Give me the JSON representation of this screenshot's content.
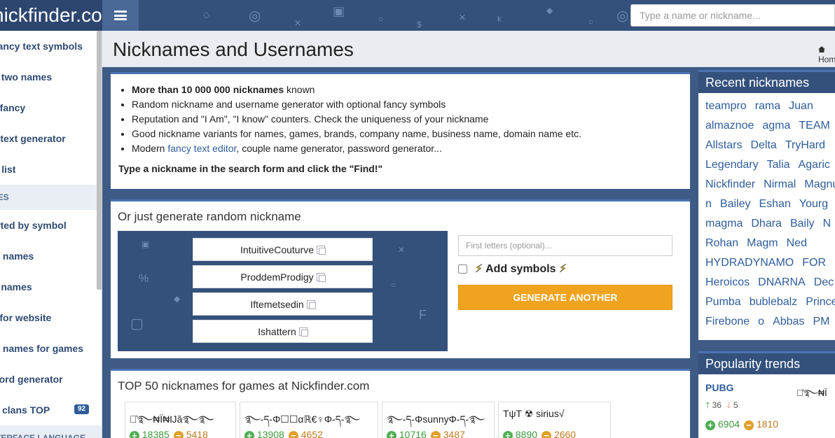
{
  "header": {
    "logo": "nickfinder.com",
    "search_placeholder": "Type a name or nickname..."
  },
  "sidebar": {
    "items": [
      {
        "label": "Fancy text symbols",
        "type": "item"
      },
      {
        "label": "Combine two names",
        "type": "item"
      },
      {
        "label": "Text fancy",
        "type": "item"
      },
      {
        "label": "Fancy text generator",
        "type": "item"
      },
      {
        "label": "Symbols list",
        "type": "item"
      },
      {
        "label": "NICKNAMES",
        "type": "section"
      },
      {
        "label": "Nicknames sorted by symbol",
        "type": "item"
      },
      {
        "label": "Random names",
        "type": "item"
      },
      {
        "label": "Couple names",
        "type": "item"
      },
      {
        "label": "Usernames for website",
        "type": "item"
      },
      {
        "label": "Random names for games",
        "type": "item"
      },
      {
        "label": "Password generator",
        "type": "item"
      },
      {
        "label": "Gaming clans TOP",
        "type": "item",
        "badge": "92"
      },
      {
        "label": "INTERFACE LANGUAGE",
        "type": "section"
      }
    ]
  },
  "page": {
    "title": "Nicknames and Usernames",
    "breadcrumb": "Home"
  },
  "intro": {
    "bullet1_bold": "More than 10 000 000 nicknames",
    "bullet1_rest": " known",
    "bullet2": "Random nickname and username generator with optional fancy symbols",
    "bullet3": "Reputation and \"I Am\", \"I know\" counters. Check the uniqueness of your nickname",
    "bullet4": "Good nickname variants for names, games, brands, company name, business name, domain name etc.",
    "bullet5_pre": "Modern ",
    "bullet5_link": "fancy text editor",
    "bullet5_post": ", couple name generator, password generator...",
    "cta": "Type a nickname in the search form and click the \"Find!\""
  },
  "generator": {
    "heading": "Or just generate random nickname",
    "names": [
      "IntuitiveCouturve",
      "ProddemProdigy",
      "Iftemetsedin",
      "Ishattern"
    ],
    "first_letters_placeholder": "First letters (optional)...",
    "add_symbols_label": "Add symbols",
    "button_label": "GENERATE ANOTHER"
  },
  "top": {
    "heading": "TOP 50 nicknames for games at Nickfinder.com",
    "cards": [
      {
        "nick": "࿐͐࿐₦Ï₦Ĳă࿐࿐",
        "up": "18385",
        "down": "5418"
      },
      {
        "nick": "࿐-ད-Φ☐☐αℝ€♀Φ-ད-࿐",
        "up": "13908",
        "down": "4652"
      },
      {
        "nick": "࿐-ད-ΦsunnyΦ-ད-࿐",
        "up": "10716",
        "down": "3487"
      },
      {
        "nick": "TψT ☢ sirius√",
        "up": "8890",
        "down": "2660"
      }
    ]
  },
  "recent": {
    "heading": "Recent nicknames",
    "rows": [
      [
        "teampro",
        "rama",
        "Juan"
      ],
      [
        "almaznoe",
        "agma",
        "TEAM"
      ],
      [
        "Allstars",
        "Delta",
        "TryHard"
      ],
      [
        "Legendary",
        "Talia",
        "Agaric"
      ],
      [
        "Nickfinder",
        "Nirmal",
        "Magnus"
      ],
      [
        "n",
        "Bailey",
        "Eshan",
        "Yourg"
      ],
      [
        "magma",
        "Dhara",
        "Baily",
        "N"
      ],
      [
        "Rohan",
        "Magm",
        "Ned"
      ],
      [
        "HYDRADYNAMO",
        "FOR"
      ],
      [
        "Heroicos",
        "DNARNA",
        "Dec"
      ],
      [
        "Pumba",
        "bublebalz",
        "Prince"
      ],
      [
        "Firebone",
        "o",
        "Abbas",
        "PM"
      ]
    ]
  },
  "trends": {
    "heading": "Popularity trends",
    "name": "PUBG",
    "up_arrow": "36",
    "down_arrow": "5",
    "up": "6904",
    "down": "1810",
    "fancy": "࿐͐࿐₦Ï"
  },
  "colors": {
    "accent": "#4c73b1",
    "header_bg": "#34517c",
    "button": "#f0a31f",
    "link": "#2e5d9a"
  }
}
